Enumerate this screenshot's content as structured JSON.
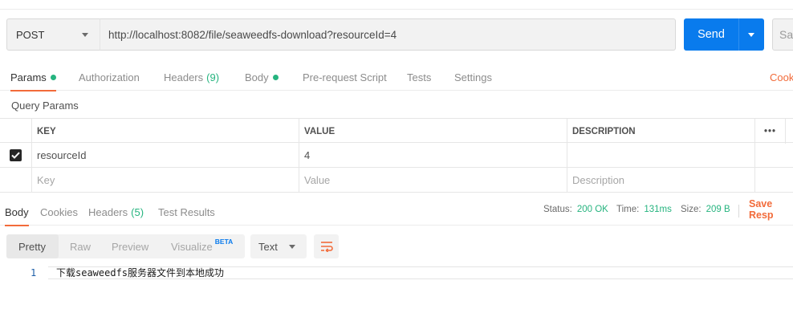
{
  "request": {
    "method": "POST",
    "url": "http://localhost:8082/file/seaweedfs-download?resourceId=4",
    "send_label": "Send",
    "save_label": "Sav"
  },
  "request_tabs": [
    {
      "label": "Params",
      "dot": true,
      "active": true
    },
    {
      "label": "Authorization"
    },
    {
      "label": "Headers",
      "count": "(9)"
    },
    {
      "label": "Body",
      "dot": true
    },
    {
      "label": "Pre-request Script"
    },
    {
      "label": "Tests"
    },
    {
      "label": "Settings"
    }
  ],
  "cookies_link": "Cook",
  "query_params": {
    "title": "Query Params",
    "columns": {
      "key": "KEY",
      "value": "VALUE",
      "description": "DESCRIPTION",
      "more": "•••"
    },
    "rows": [
      {
        "checked": true,
        "key": "resourceId",
        "value": "4",
        "description": ""
      }
    ],
    "placeholders": {
      "key": "Key",
      "value": "Value",
      "description": "Description"
    }
  },
  "response_tabs": [
    {
      "label": "Body",
      "active": true
    },
    {
      "label": "Cookies"
    },
    {
      "label": "Headers",
      "count": "(5)"
    },
    {
      "label": "Test Results"
    }
  ],
  "response_status": {
    "status_label": "Status:",
    "status_value": "200 OK",
    "time_label": "Time:",
    "time_value": "131ms",
    "size_label": "Size:",
    "size_value": "209 B",
    "save_response": "Save Resp"
  },
  "view_modes": {
    "pretty": "Pretty",
    "raw": "Raw",
    "preview": "Preview",
    "visualize": "Visualize",
    "beta": "BETA",
    "format": "Text"
  },
  "response_body": {
    "line_number": "1",
    "text": "下载seaweedfs服务器文件到本地成功"
  },
  "colors": {
    "accent": "#097bed",
    "tab_indicator": "#f26b3a",
    "success": "#26b47f"
  }
}
